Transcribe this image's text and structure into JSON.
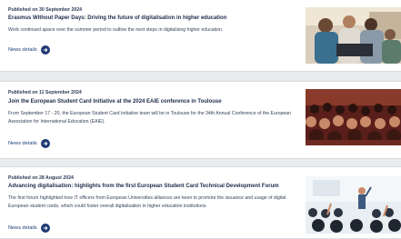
{
  "articles": [
    {
      "date": "Published on 30 September 2024",
      "title": "Erasmus Without Paper Days: Driving the future of digitalisation in higher education",
      "description": "Work continued apace over the summer period to outline the next steps in digitalising higher education.",
      "link_label": "News details",
      "image": "students-collaborating-photo"
    },
    {
      "date": "Published on 11 September 2024",
      "title": "Join the European Student Card Initiative at the 2024 EAIE conference in Toulouse",
      "description": "From September 17 - 20, the European Student Card Initiative team will be in Toulouse for the 34th Annual Conference of the European Association for International Education (EAIE).",
      "link_label": "News details",
      "image": "conference-audience-photo"
    },
    {
      "date": "Published on 28 August 2024",
      "title": "Advancing digitalisation: highlights from the first European Student Card Technical Development Forum",
      "description": "The first forum highlighted how IT officers from European Universities alliances are keen to promote the issuance and usage of digital European student cards, which could foster overall digitalisation in higher education institutions.",
      "link_label": "News details",
      "image": "lecture-hall-photo"
    }
  ]
}
